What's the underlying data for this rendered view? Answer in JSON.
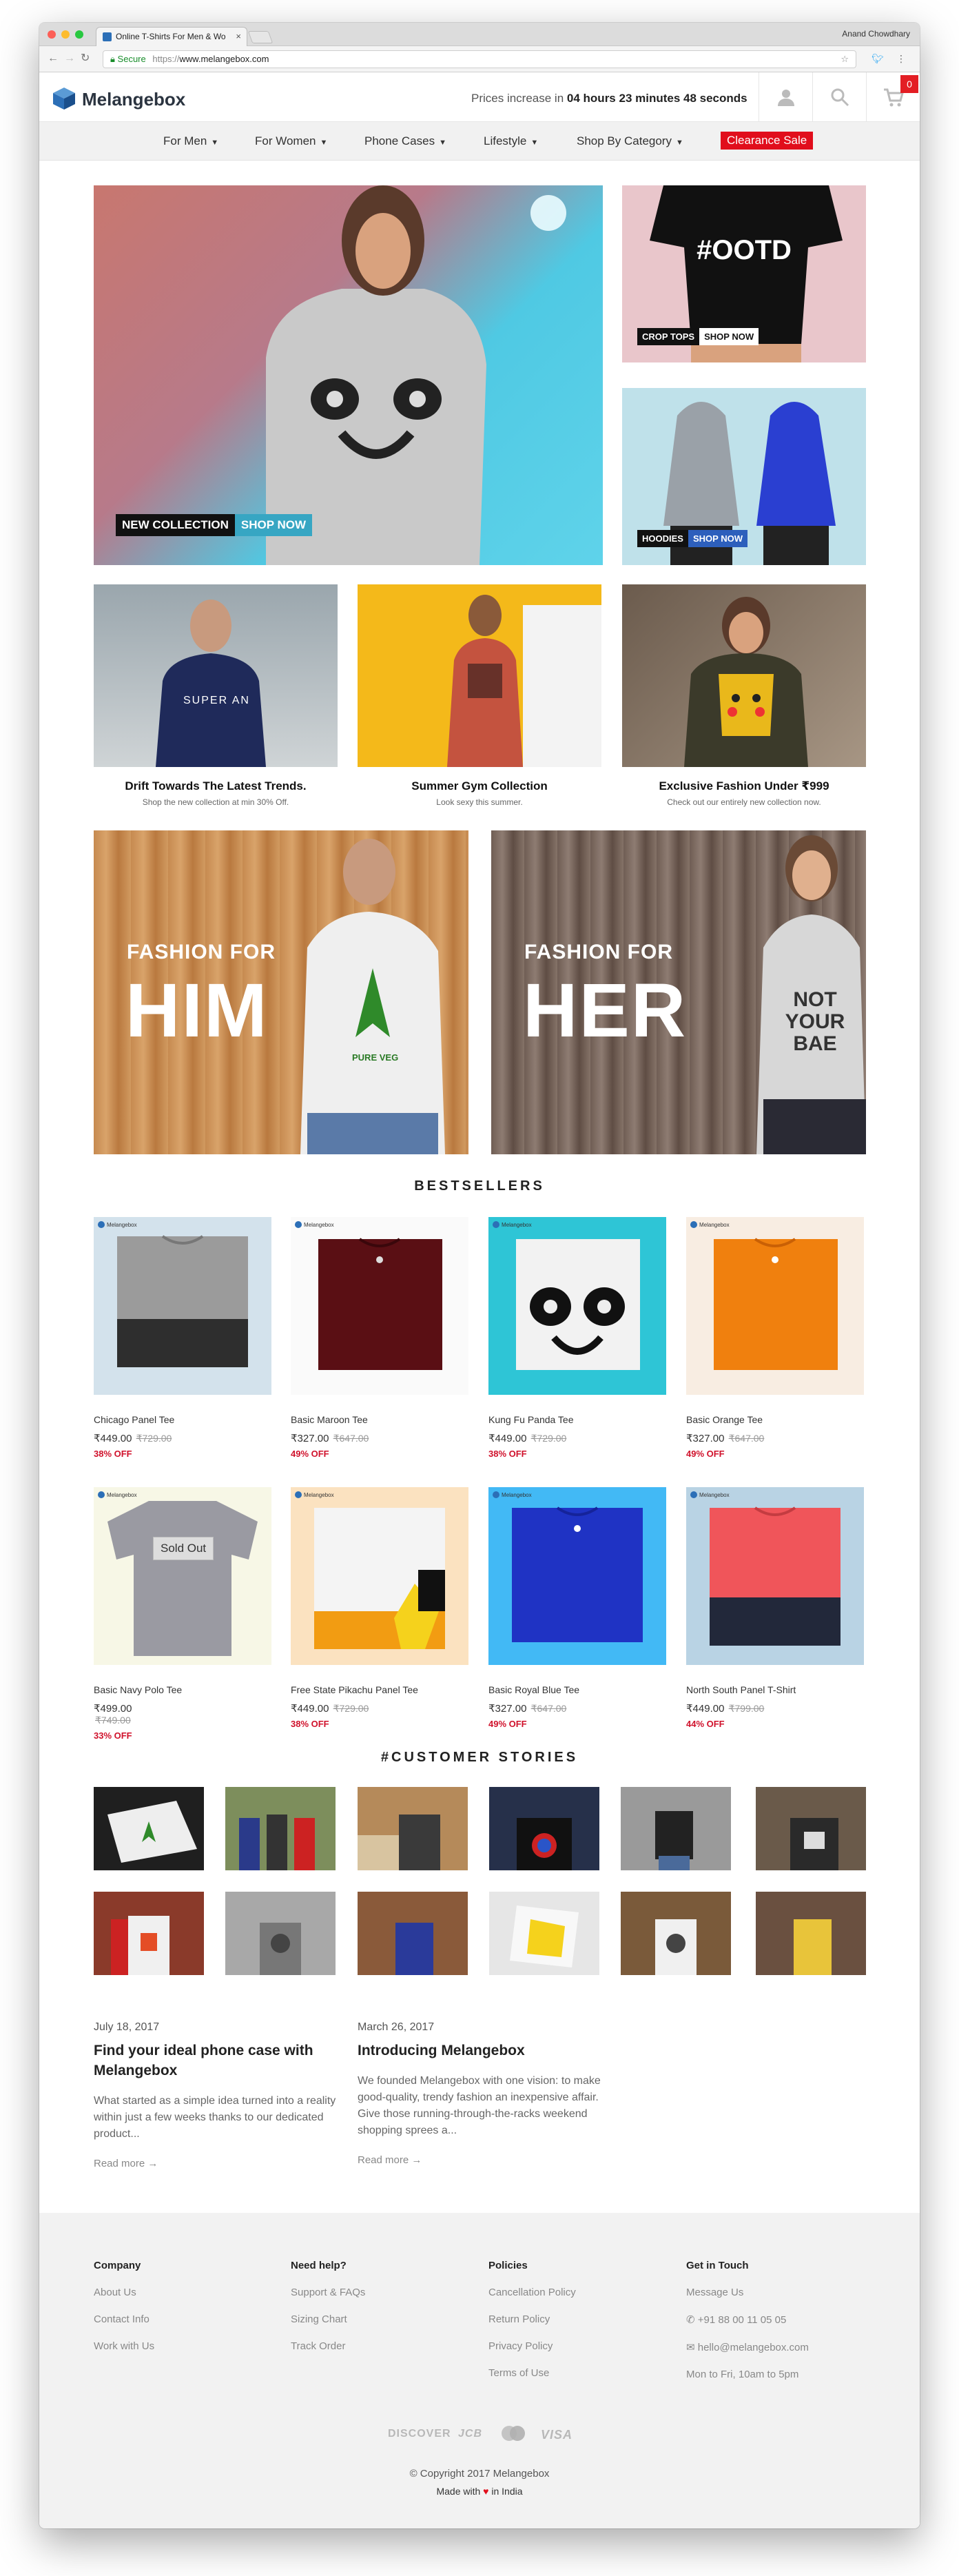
{
  "browser": {
    "tab_title": "Online T-Shirts For Men & Wo",
    "tab_close": "×",
    "profile_name": "Anand Chowdhary",
    "secure_label": "Secure",
    "url_scheme": "https://",
    "url_host": "www.melangebox.com"
  },
  "header": {
    "logo": "Melangebox",
    "timer_prefix": "Prices increase in",
    "timer_value": "04 hours 23 minutes 48 seconds",
    "cart_count": "0"
  },
  "nav": {
    "items": [
      "For Men",
      "For Women",
      "Phone Cases",
      "Lifestyle",
      "Shop By Category"
    ],
    "clearance": "Clearance Sale"
  },
  "hero": {
    "main": {
      "label": "NEW COLLECTION",
      "cta": "SHOP NOW"
    },
    "side1": {
      "label": "CROP TOPS",
      "cta": "SHOP NOW",
      "shirt_text": "#OOTD"
    },
    "side2": {
      "label": "HOODIES",
      "cta": "SHOP NOW"
    }
  },
  "promos": [
    {
      "title": "Drift Towards The Latest Trends.",
      "sub": "Shop the new collection at min 30% Off.",
      "shirt_text": "SUPER AN"
    },
    {
      "title": "Summer Gym Collection",
      "sub": "Look sexy this summer."
    },
    {
      "title": "Exclusive Fashion Under ₹999",
      "sub": "Check out our entirely new collection now."
    }
  ],
  "fashion": {
    "him": {
      "small": "FASHION FOR",
      "big": "HIM",
      "shirt_text": "PURE VEG"
    },
    "her": {
      "small": "FASHION FOR",
      "big": "HER",
      "shirt_text": "NOT YOUR BAE"
    }
  },
  "bestsellers": {
    "title": "BESTSELLERS",
    "brand_mark": "Melangebox",
    "sold_out": "Sold Out",
    "products": [
      {
        "name": "Chicago Panel Tee",
        "price": "₹449.00",
        "mrp": "₹729.00",
        "off": "38% OFF"
      },
      {
        "name": "Basic Maroon Tee",
        "price": "₹327.00",
        "mrp": "₹647.00",
        "off": "49% OFF"
      },
      {
        "name": "Kung Fu Panda Tee",
        "price": "₹449.00",
        "mrp": "₹729.00",
        "off": "38% OFF"
      },
      {
        "name": "Basic Orange Tee",
        "price": "₹327.00",
        "mrp": "₹647.00",
        "off": "49% OFF"
      },
      {
        "name": "Basic Navy Polo Tee",
        "price": "₹499.00",
        "mrp": "₹749.00",
        "off": "33% OFF"
      },
      {
        "name": "Free State Pikachu Panel Tee",
        "price": "₹449.00",
        "mrp": "₹729.00",
        "off": "38% OFF"
      },
      {
        "name": "Basic Royal Blue Tee",
        "price": "₹327.00",
        "mrp": "₹647.00",
        "off": "49% OFF"
      },
      {
        "name": "North South Panel T-Shirt",
        "price": "₹449.00",
        "mrp": "₹799.00",
        "off": "44% OFF"
      }
    ]
  },
  "stories": {
    "title": "#CUSTOMER STORIES"
  },
  "blog": [
    {
      "date": "July 18, 2017",
      "title": "Find your ideal phone case with Melangebox",
      "excerpt": "What started as a simple idea turned into a reality within just a few weeks thanks to our dedicated product...",
      "more": "Read more →"
    },
    {
      "date": "March 26, 2017",
      "title": "Introducing Melangebox",
      "excerpt": "We founded Melangebox with one vision: to make good-quality, trendy fashion an inexpensive affair. Give those running-through-the-racks weekend shopping sprees a...",
      "more": "Read more →"
    }
  ],
  "footer": {
    "company": {
      "title": "Company",
      "links": [
        "About Us",
        "Contact Info",
        "Work with Us"
      ]
    },
    "help": {
      "title": "Need help?",
      "links": [
        "Support & FAQs",
        "Sizing Chart",
        "Track Order"
      ]
    },
    "policies": {
      "title": "Policies",
      "links": [
        "Cancellation Policy",
        "Return Policy",
        "Privacy Policy",
        "Terms of Use"
      ]
    },
    "contact": {
      "title": "Get in Touch",
      "message": "Message Us",
      "phone": "+91 88 00 11 05 05",
      "email": "hello@melangebox.com",
      "hours": "Mon to Fri, 10am to 5pm"
    },
    "payments": [
      "DISCOVER",
      "JCB",
      "MasterCard",
      "VISA"
    ],
    "copyright": "© Copyright 2017 Melangebox",
    "made_prefix": "Made with",
    "made_suffix": "in India"
  }
}
